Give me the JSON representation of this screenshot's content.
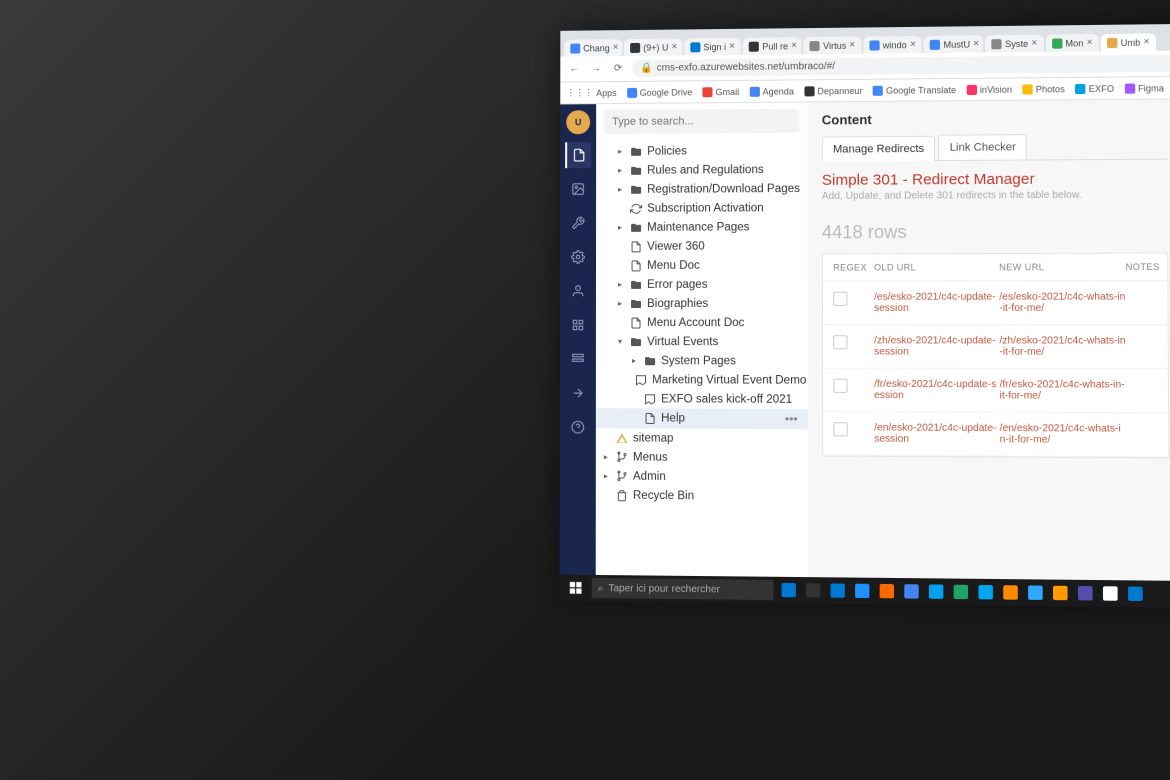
{
  "browser": {
    "tabs": [
      {
        "label": "Chang",
        "favicon": "#4285f4"
      },
      {
        "label": "(9+) U",
        "favicon": "#333"
      },
      {
        "label": "Sign i",
        "favicon": "#0078d4"
      },
      {
        "label": "Pull re",
        "favicon": "#333"
      },
      {
        "label": "Virtus",
        "favicon": "#888"
      },
      {
        "label": "windo",
        "favicon": "#4285f4"
      },
      {
        "label": "MustU",
        "favicon": "#4285f4"
      },
      {
        "label": "Syste",
        "favicon": "#888"
      },
      {
        "label": "Mon",
        "favicon": "#34a853"
      },
      {
        "label": "Umb",
        "favicon": "#e6a94c"
      }
    ],
    "url": "cms-exfo.azurewebsites.net/umbraco/#/",
    "bookmarks_label": "Apps",
    "bookmarks": [
      {
        "label": "Google Drive",
        "color": "#4285f4"
      },
      {
        "label": "Gmail",
        "color": "#ea4335"
      },
      {
        "label": "Agenda",
        "color": "#4285f4"
      },
      {
        "label": "Depanneur",
        "color": "#333"
      },
      {
        "label": "Google Translate",
        "color": "#4285f4"
      },
      {
        "label": "inVision",
        "color": "#ff3366"
      },
      {
        "label": "Photos",
        "color": "#fbbc04"
      },
      {
        "label": "EXFO",
        "color": "#00a0e1"
      },
      {
        "label": "Figma",
        "color": "#a259ff"
      }
    ]
  },
  "umbraco": {
    "search_placeholder": "Type to search...",
    "tree": [
      {
        "label": "Policies",
        "icon": "folder",
        "depth": 1,
        "caret": "▸"
      },
      {
        "label": "Rules and Regulations",
        "icon": "folder",
        "depth": 1,
        "caret": "▸"
      },
      {
        "label": "Registration/Download Pages",
        "icon": "folder",
        "depth": 1,
        "caret": "▸"
      },
      {
        "label": "Subscription Activation",
        "icon": "refresh",
        "depth": 1,
        "caret": ""
      },
      {
        "label": "Maintenance Pages",
        "icon": "folder",
        "depth": 1,
        "caret": "▸"
      },
      {
        "label": "Viewer 360",
        "icon": "doc",
        "depth": 1,
        "caret": ""
      },
      {
        "label": "Menu Doc",
        "icon": "doc",
        "depth": 1,
        "caret": ""
      },
      {
        "label": "Error pages",
        "icon": "folder",
        "depth": 1,
        "caret": "▸"
      },
      {
        "label": "Biographies",
        "icon": "folder",
        "depth": 1,
        "caret": "▸"
      },
      {
        "label": "Menu Account Doc",
        "icon": "doc",
        "depth": 1,
        "caret": ""
      },
      {
        "label": "Virtual Events",
        "icon": "folder",
        "depth": 1,
        "caret": "▾"
      },
      {
        "label": "System Pages",
        "icon": "folder",
        "depth": 2,
        "caret": "▸"
      },
      {
        "label": "Marketing Virtual Event Demo",
        "icon": "event",
        "depth": 2,
        "caret": ""
      },
      {
        "label": "EXFO sales kick-off 2021",
        "icon": "event",
        "depth": 2,
        "caret": ""
      },
      {
        "label": "Help",
        "icon": "doc",
        "depth": 2,
        "caret": "",
        "selected": true,
        "dots": true
      },
      {
        "label": "sitemap",
        "icon": "warn",
        "depth": 0,
        "caret": "",
        "warn": true
      },
      {
        "label": "Menus",
        "icon": "fork",
        "depth": 0,
        "caret": "▸"
      },
      {
        "label": "Admin",
        "icon": "fork",
        "depth": 0,
        "caret": "▸"
      },
      {
        "label": "Recycle Bin",
        "icon": "trash",
        "depth": 0,
        "caret": ""
      }
    ]
  },
  "main": {
    "section_title": "Content",
    "tabs": [
      {
        "label": "Manage Redirects",
        "active": true
      },
      {
        "label": "Link Checker",
        "active": false
      }
    ],
    "page_title": "Simple 301 - Redirect Manager",
    "page_subtitle": "Add, Update, and Delete 301 redirects in the table below.",
    "row_count": "4418 rows",
    "columns": {
      "regex": "REGEX",
      "old": "OLD URL",
      "new": "NEW URL",
      "notes": "NOTES"
    },
    "rows": [
      {
        "old": "/es/esko-2021/c4c-update-session",
        "new": "/es/esko-2021/c4c-whats-in-it-for-me/"
      },
      {
        "old": "/zh/esko-2021/c4c-update-session",
        "new": "/zh/esko-2021/c4c-whats-in-it-for-me/"
      },
      {
        "old": "/fr/esko-2021/c4c-update-session",
        "new": "/fr/esko-2021/c4c-whats-in-it-for-me/"
      },
      {
        "old": "/en/esko-2021/c4c-update-session",
        "new": "/en/esko-2021/c4c-whats-in-it-for-me/"
      }
    ]
  },
  "taskbar": {
    "search_placeholder": "Taper ici pour rechercher",
    "icons": [
      "#0078d4",
      "#333",
      "#0078d4",
      "#1e90ff",
      "#ff6a00",
      "#4285f4",
      "#00a1f1",
      "#21a366",
      "#00a4ef",
      "#ff8c00",
      "#31a8ff",
      "#ff9a00",
      "#584caf",
      "#fff",
      "#007acc"
    ]
  }
}
